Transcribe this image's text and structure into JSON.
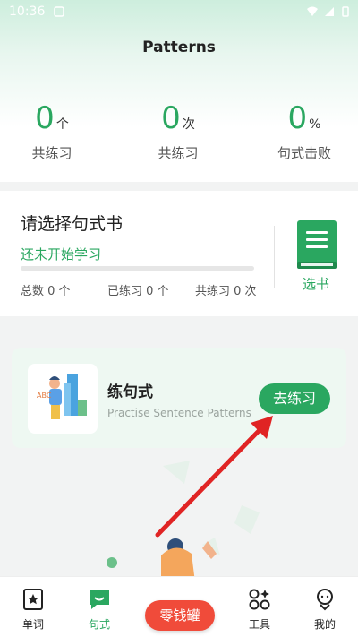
{
  "status_bar": {
    "time": "10:36"
  },
  "header": {
    "title": "Patterns"
  },
  "stats": [
    {
      "value": "0",
      "unit": "个",
      "label": "共练习"
    },
    {
      "value": "0",
      "unit": "次",
      "label": "共练习"
    },
    {
      "value": "0",
      "unit": "%",
      "label": "句式击败"
    }
  ],
  "book": {
    "title": "请选择句式书",
    "status": "还未开始学习",
    "progress": 0,
    "total_label": "总数 0 个",
    "practiced_label": "已练习 0 个",
    "times_label": "共练习 0 次",
    "select_label": "选书"
  },
  "practice": {
    "title": "练句式",
    "subtitle": "Practise Sentence Patterns",
    "button": "去练习"
  },
  "tabbar": {
    "items": [
      {
        "label": "单词",
        "icon": "bookmark-icon"
      },
      {
        "label": "句式",
        "icon": "chat-icon"
      },
      {
        "label": "工具",
        "icon": "tools-icon"
      },
      {
        "label": "我的",
        "icon": "profile-icon"
      }
    ],
    "center_label": "零钱罐"
  },
  "colors": {
    "accent": "#2aa760",
    "center": "#f04b3a",
    "arrow": "#e02424"
  }
}
